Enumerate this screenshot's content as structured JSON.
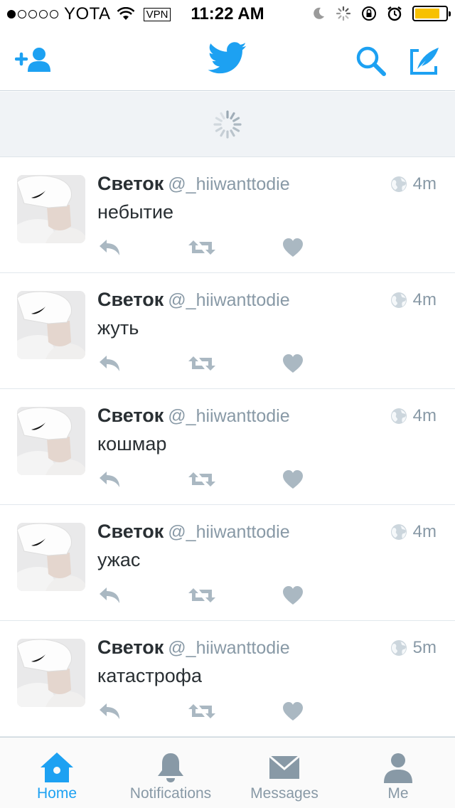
{
  "status_bar": {
    "carrier": "YOTA",
    "vpn": "VPN",
    "time": "11:22 AM",
    "signal_bars_on": 1,
    "signal_bars_total": 5,
    "battery_level": 0.8,
    "battery_color": "#f7c100"
  },
  "nav": {
    "add_icon": "add-user-icon",
    "logo_icon": "twitter-bird-icon",
    "search_icon": "search-icon",
    "compose_icon": "compose-icon",
    "accent": "#1da1f2"
  },
  "timeline": {
    "tweets": [
      {
        "name": "Светок",
        "handle": "@_hiiwanttodie",
        "time": "4m",
        "text": "небытие"
      },
      {
        "name": "Светок",
        "handle": "@_hiiwanttodie",
        "time": "4m",
        "text": "жуть"
      },
      {
        "name": "Светок",
        "handle": "@_hiiwanttodie",
        "time": "4m",
        "text": "кошмар"
      },
      {
        "name": "Светок",
        "handle": "@_hiiwanttodie",
        "time": "4m",
        "text": "ужас"
      },
      {
        "name": "Светок",
        "handle": "@_hiiwanttodie",
        "time": "5m",
        "text": "катастрофа"
      }
    ]
  },
  "tabs": [
    {
      "label": "Home",
      "icon": "home-icon",
      "active": true
    },
    {
      "label": "Notifications",
      "icon": "bell-icon",
      "active": false
    },
    {
      "label": "Messages",
      "icon": "envelope-icon",
      "active": false
    },
    {
      "label": "Me",
      "icon": "person-icon",
      "active": false
    }
  ]
}
